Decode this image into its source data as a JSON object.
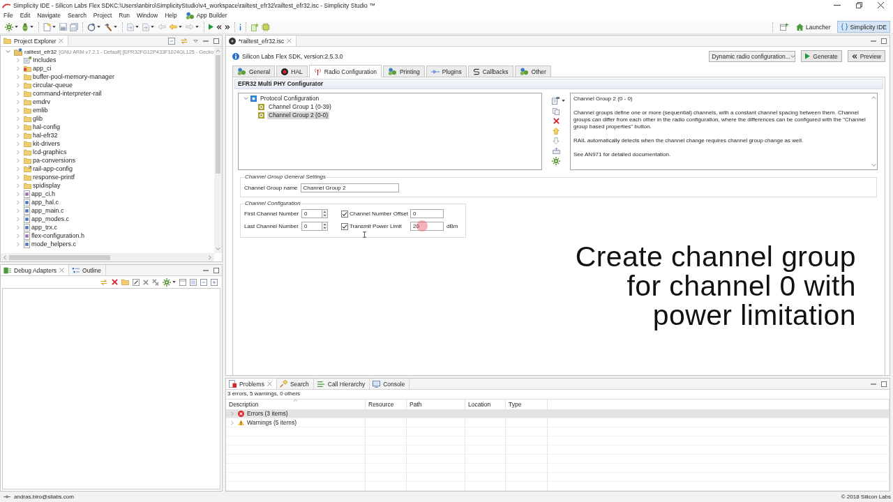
{
  "window": {
    "title": "Simplicity IDE - Silicon Labs Flex SDKC:\\Users\\anbiro\\SimplicityStudio\\v4_workspace\\railtest_efr32\\railtest_efr32.isc - Simplicity Studio ™"
  },
  "menu": {
    "items": [
      "File",
      "Edit",
      "Navigate",
      "Search",
      "Project",
      "Run",
      "Window",
      "Help"
    ],
    "app_builder": "App Builder"
  },
  "perspectives": [
    {
      "label": "Launcher",
      "kind": "launcher",
      "selected": false
    },
    {
      "label": "Simplicity IDE",
      "kind": "ide",
      "selected": true
    }
  ],
  "project_explorer": {
    "title": "Project Explorer",
    "tree": {
      "label": "railtest_efr32",
      "detail": "[GNU ARM v7.2.1 - Default] [EFR32FG12P433F1024GL125 - Gecko",
      "expanded": true,
      "children": [
        {
          "label": "Includes",
          "kind": "includes",
          "expanded": false
        },
        {
          "label": "app_ci",
          "kind": "source-folder",
          "expanded": false
        },
        {
          "label": "buffer-pool-memory-manager",
          "kind": "folder",
          "expanded": false
        },
        {
          "label": "circular-queue",
          "kind": "folder",
          "expanded": false
        },
        {
          "label": "command-interpreter-rail",
          "kind": "folder",
          "expanded": false
        },
        {
          "label": "emdrv",
          "kind": "folder",
          "expanded": false
        },
        {
          "label": "emlib",
          "kind": "folder",
          "expanded": false
        },
        {
          "label": "glib",
          "kind": "folder",
          "expanded": false
        },
        {
          "label": "hal-config",
          "kind": "folder",
          "expanded": false
        },
        {
          "label": "hal-efr32",
          "kind": "folder",
          "expanded": false
        },
        {
          "label": "kit-drivers",
          "kind": "folder",
          "expanded": false
        },
        {
          "label": "lcd-graphics",
          "kind": "folder",
          "expanded": false
        },
        {
          "label": "pa-conversions",
          "kind": "folder",
          "expanded": false
        },
        {
          "label": "rail-app-config",
          "kind": "linked-folder",
          "expanded": false
        },
        {
          "label": "response-printf",
          "kind": "folder",
          "expanded": false
        },
        {
          "label": "spidisplay",
          "kind": "folder",
          "expanded": false
        },
        {
          "label": "app_ci.h",
          "kind": "header",
          "expanded": false
        },
        {
          "label": "app_hal.c",
          "kind": "source",
          "expanded": false
        },
        {
          "label": "app_main.c",
          "kind": "source",
          "expanded": false
        },
        {
          "label": "app_modes.c",
          "kind": "source",
          "expanded": false
        },
        {
          "label": "app_trx.c",
          "kind": "source",
          "expanded": false
        },
        {
          "label": "flex-configuration.h",
          "kind": "header",
          "expanded": false
        },
        {
          "label": "mode_helpers.c",
          "kind": "source",
          "expanded": false
        }
      ]
    }
  },
  "debug_panel": {
    "tabs": [
      {
        "label": "Debug Adapters",
        "kind": "debug-adapters",
        "selected": true
      },
      {
        "label": "Outline",
        "kind": "outline",
        "selected": false
      }
    ]
  },
  "editor": {
    "tab": "*railtest_efr32.isc",
    "sdk_info": "Silicon Labs Flex SDK, version:2.5.3.0",
    "config_dropdown": "Dynamic radio configuration...",
    "buttons": [
      {
        "label": "Generate",
        "kind": "generate"
      },
      {
        "label": "Preview",
        "kind": "preview"
      }
    ],
    "tabs": [
      {
        "label": "General",
        "kind": "general",
        "selected": false
      },
      {
        "label": "HAL",
        "kind": "hal",
        "selected": false
      },
      {
        "label": "Radio Configuration",
        "kind": "radio",
        "selected": true
      },
      {
        "label": "Printing",
        "kind": "printing",
        "selected": false
      },
      {
        "label": "Plugins",
        "kind": "plugins",
        "selected": false
      },
      {
        "label": "Callbacks",
        "kind": "callbacks",
        "selected": false
      },
      {
        "label": "Other",
        "kind": "other",
        "selected": false
      }
    ],
    "section_title": "EFR32 Multi PHY Configurator",
    "protocol_tree": {
      "label": "Protocol Configuration",
      "expanded": true,
      "children": [
        {
          "label": "Channel Group 1 (0-39)",
          "selected": false
        },
        {
          "label": "Channel Group 2 (0-0)",
          "selected": true
        }
      ]
    },
    "description": {
      "title": "Channel Group 2 (0 - 0)",
      "paragraphs": [
        "Channel groups define one or more (sequential) channels, with a constant channel spacing between them. Channel groups can differ from each other in the radio configuration, where the differences can be configured with the \"Channel group based properties\" button.",
        "RAIL automatically detects when the channel change requires channel group change as well.",
        "See AN971 for detailed documentation."
      ]
    },
    "general_settings": {
      "title": "Channel Group General Settings",
      "fields": [
        {
          "label": "Channel Group name",
          "value": "Channel Group 2"
        }
      ]
    },
    "channel_configuration": {
      "title": "Channel Configuration",
      "rows": [
        {
          "spinner": {
            "label": "First Channel Number",
            "value": "0"
          },
          "option": {
            "label": "Channel Number Offset",
            "checked": true,
            "value": "0"
          }
        },
        {
          "spinner": {
            "label": "Last Channel Number",
            "value": "0"
          },
          "option": {
            "label": "Transmit Power Limit",
            "checked": true,
            "value": "20",
            "unit": "dBm"
          }
        }
      ]
    },
    "caption": "Create channel group for channel 0 with power limitation"
  },
  "problems_panel": {
    "tabs": [
      {
        "label": "Problems",
        "kind": "problems",
        "selected": true
      },
      {
        "label": "Search",
        "kind": "search",
        "selected": false
      },
      {
        "label": "Call Hierarchy",
        "kind": "call-hierarchy",
        "selected": false
      },
      {
        "label": "Console",
        "kind": "console",
        "selected": false
      }
    ],
    "summary": "3 errors, 5 warnings, 0 others",
    "columns": [
      {
        "label": "Description",
        "sorted": true
      },
      {
        "label": "Resource",
        "sorted": false
      },
      {
        "label": "Path",
        "sorted": false
      },
      {
        "label": "Location",
        "sorted": false
      },
      {
        "label": "Type",
        "sorted": false
      }
    ],
    "rows": [
      {
        "label": "Errors (3 items)",
        "kind": "error",
        "selected": true,
        "expanded": false
      },
      {
        "label": "Warnings (5 items)",
        "kind": "warning",
        "selected": false,
        "expanded": false
      }
    ]
  },
  "status_bar": {
    "user": "andras.biro@silabs.com",
    "copyright": "© 2018 Silicon Labs"
  }
}
